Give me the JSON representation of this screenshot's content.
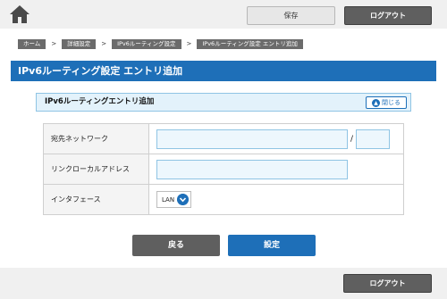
{
  "header": {
    "save_label": "保存",
    "logout_label": "ログアウト"
  },
  "breadcrumb": [
    "ホーム",
    "詳細設定",
    "IPv6ルーティング設定",
    "IPv6ルーティング設定 エントリ追加"
  ],
  "breadcrumb_separator": ">",
  "page_title": "IPv6ルーティング設定 エントリ追加",
  "section": {
    "title": "IPv6ルーティングエントリ追加",
    "collapse_label": "閉じる"
  },
  "form": {
    "destination_label": "宛先ネットワーク",
    "destination_value": "",
    "prefix_separator": "/",
    "prefix_value": "",
    "link_local_label": "リンクローカルアドレス",
    "link_local_value": "",
    "interface_label": "インタフェース",
    "interface_value": "LAN"
  },
  "actions": {
    "back_label": "戻る",
    "apply_label": "設定"
  },
  "footer": {
    "logout_label": "ログアウト"
  },
  "colors": {
    "primary": "#1e6fb8",
    "dark_button": "#5f5f5f",
    "input_bg": "#edf7fd",
    "input_border": "#8fc4e4"
  }
}
